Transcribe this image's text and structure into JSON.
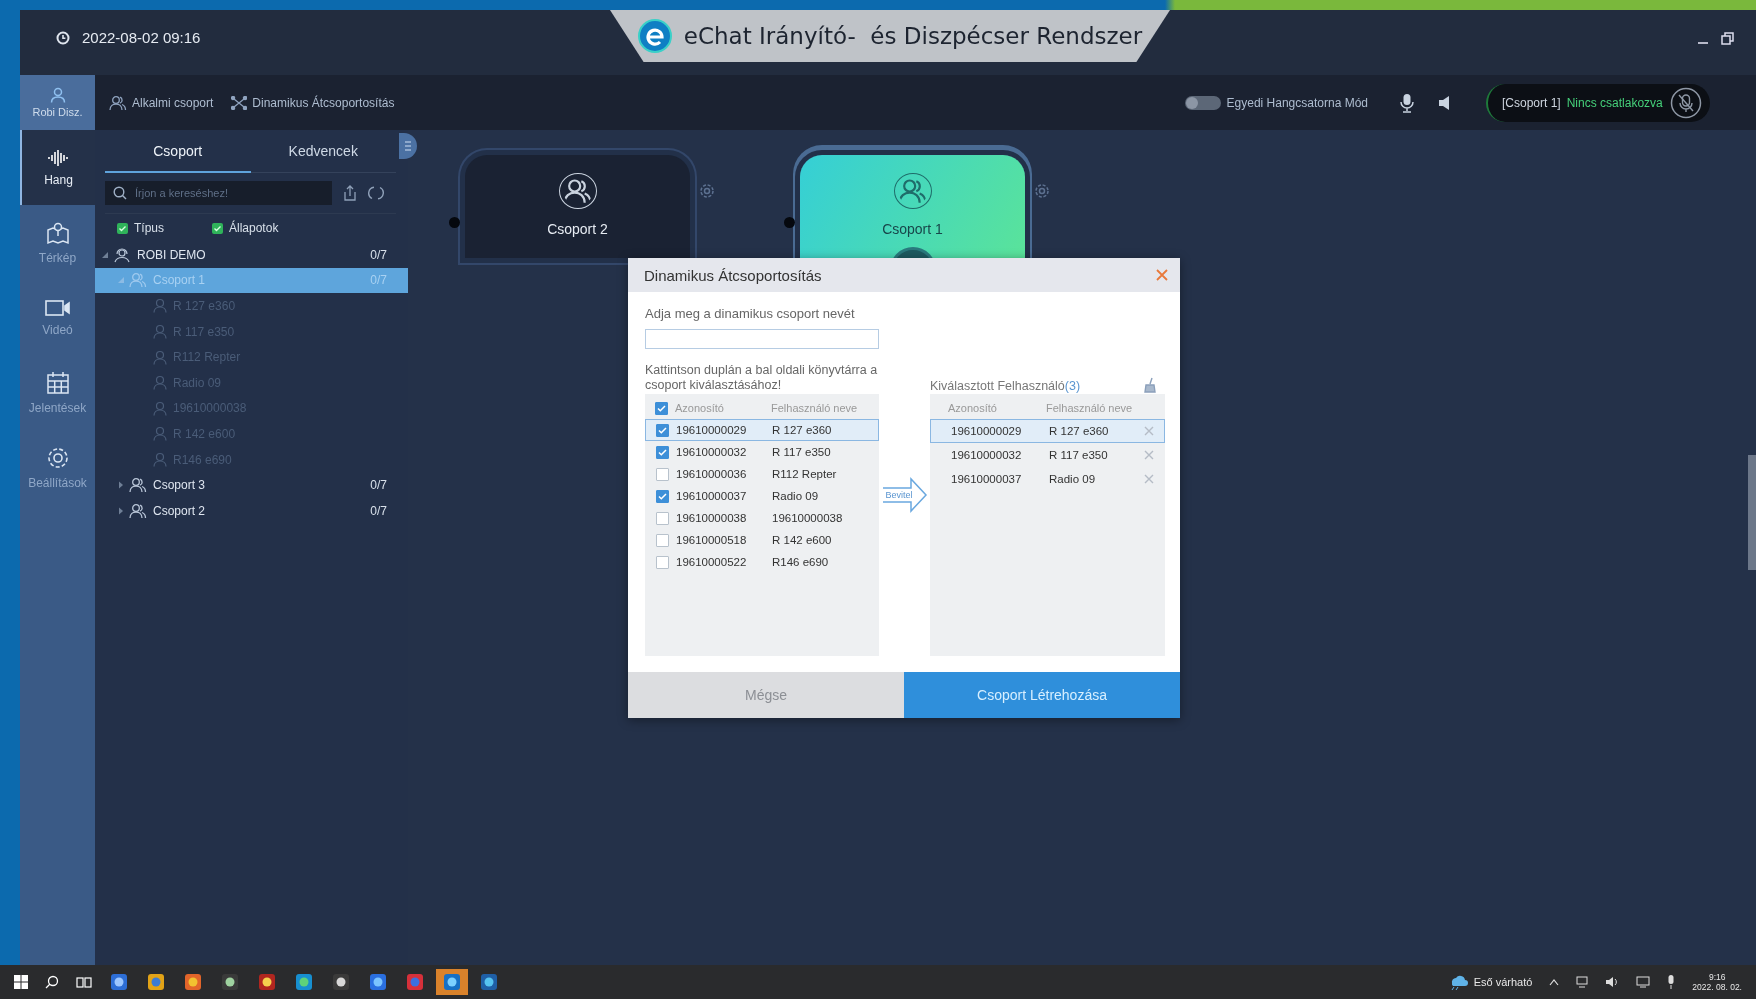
{
  "titlebar": {
    "datetime": "2022-08-02 09:16",
    "app_title": "eChat Irányító-  és Diszpécser Rendszer"
  },
  "toolbar": {
    "user": "Robi Disz.",
    "actions": [
      "Alkalmi csoport",
      "Dinamikus Átcsoportosítás"
    ],
    "mode_toggle": {
      "label": "Egyedi Hangcsatorna Mód",
      "on": false
    },
    "channel": {
      "group": "[Csoport 1]",
      "status": "Nincs csatlakozva"
    }
  },
  "nav": [
    {
      "label": "Hang",
      "selected": true
    },
    {
      "label": "Térkép",
      "selected": false
    },
    {
      "label": "Videó",
      "selected": false
    },
    {
      "label": "Jelentések",
      "selected": false
    },
    {
      "label": "Beállítások",
      "selected": false
    }
  ],
  "panel": {
    "tabs": [
      {
        "label": "Csoport",
        "selected": true
      },
      {
        "label": "Kedvencek",
        "selected": false
      }
    ],
    "search": {
      "placeholder": "Írjon a kereséshez!"
    },
    "filters": [
      {
        "label": "Típus",
        "checked": true
      },
      {
        "label": "Állapotok",
        "checked": true
      }
    ],
    "tree": [
      {
        "kind": "org",
        "label": "ROBI DEMO",
        "count": "0/7",
        "expanded": true,
        "selected": false,
        "children": [
          {
            "kind": "group",
            "label": "Csoport 1",
            "count": "0/7",
            "expanded": true,
            "selected": true,
            "children": [
              {
                "kind": "user",
                "label": "R 127 e360",
                "online": false,
                "selected": false
              },
              {
                "kind": "user",
                "label": "R 117 e350",
                "online": false,
                "selected": false
              },
              {
                "kind": "user",
                "label": "R112  Repter",
                "online": false,
                "selected": false
              },
              {
                "kind": "user",
                "label": "Radio 09",
                "online": false,
                "selected": false
              },
              {
                "kind": "user",
                "label": "19610000038",
                "online": false,
                "selected": false
              },
              {
                "kind": "user",
                "label": "R 142 e600",
                "online": false,
                "selected": false
              },
              {
                "kind": "user",
                "label": "R146 e690",
                "online": false,
                "selected": false
              }
            ]
          },
          {
            "kind": "group",
            "label": "Csoport 3",
            "count": "0/7",
            "expanded": false,
            "selected": false
          },
          {
            "kind": "group",
            "label": "Csoport 2",
            "count": "0/7",
            "expanded": false,
            "selected": false
          }
        ]
      }
    ]
  },
  "canvas": {
    "groups": [
      {
        "label": "Csoport 2",
        "active": false
      },
      {
        "label": "Csoport 1",
        "active": true
      }
    ]
  },
  "dialog": {
    "title": "Dinamikus Átcsoportosítás",
    "name_label": "Adja meg a dinamikus csoport nevét",
    "hint": "Kattintson duplán a bal oldali könyvtárra a csoport kiválasztásához!",
    "left_columns": [
      "Azonosító",
      "Felhasználó neve"
    ],
    "header_checked": true,
    "users": [
      {
        "id": "19610000029",
        "name": "R 127 e360",
        "checked": true,
        "selected": true
      },
      {
        "id": "19610000032",
        "name": "R 117 e350",
        "checked": true,
        "selected": false
      },
      {
        "id": "19610000036",
        "name": "R112  Repter",
        "checked": false,
        "selected": false
      },
      {
        "id": "19610000037",
        "name": "Radio 09",
        "checked": true,
        "selected": false
      },
      {
        "id": "19610000038",
        "name": "19610000038",
        "checked": false,
        "selected": false
      },
      {
        "id": "19610000518",
        "name": "R 142 e600",
        "checked": false,
        "selected": false
      },
      {
        "id": "19610000522",
        "name": "R146 e690",
        "checked": false,
        "selected": false
      }
    ],
    "transfer_button": "Bevitel",
    "selected_title": "Kiválasztott Felhasználó",
    "selected_count": "(3)",
    "right_columns": [
      "Azonosító",
      "Felhasználó neve"
    ],
    "selected_users": [
      {
        "id": "19610000029",
        "name": "R 127 e360",
        "selected": true
      },
      {
        "id": "19610000032",
        "name": "R 117 e350",
        "selected": false
      },
      {
        "id": "19610000037",
        "name": "Radio 09",
        "selected": false
      }
    ],
    "buttons": [
      {
        "label": "Mégse",
        "kind": "cancel"
      },
      {
        "label": "Csoport Létrehozása",
        "kind": "primary"
      }
    ]
  },
  "taskbar": {
    "weather": "Eső várható",
    "time": "9:16",
    "date": "2022. 08. 02."
  }
}
